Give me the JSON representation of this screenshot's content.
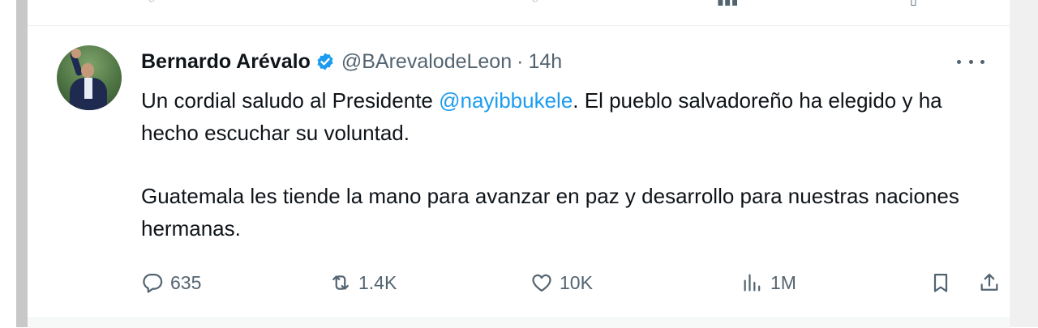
{
  "tweet": {
    "author": {
      "name": "Bernardo Arévalo",
      "handle": "@BArevalodeLeon",
      "separator": "·",
      "time": "14h",
      "verified": true
    },
    "text": {
      "line1_before": "Un cordial saludo al Presidente ",
      "mention": "@nayibbukele",
      "line1_after": ". El pueblo salvadoreño ha elegido y ha hecho escuchar su voluntad.",
      "paragraph2": "Guatemala les tiende la mano para avanzar en paz y desarrollo para nuestras naciones hermanas."
    },
    "actions": {
      "replies": "635",
      "reposts": "1.4K",
      "likes": "10K",
      "views": "1M"
    }
  },
  "colors": {
    "text": "#0f1419",
    "secondary": "#536471",
    "accent": "#1d9bf0",
    "divider": "#eff3f4"
  },
  "icons": [
    "verified-badge-icon",
    "more-icon",
    "reply-icon",
    "repost-icon",
    "like-icon",
    "views-icon",
    "bookmark-icon",
    "share-icon"
  ]
}
